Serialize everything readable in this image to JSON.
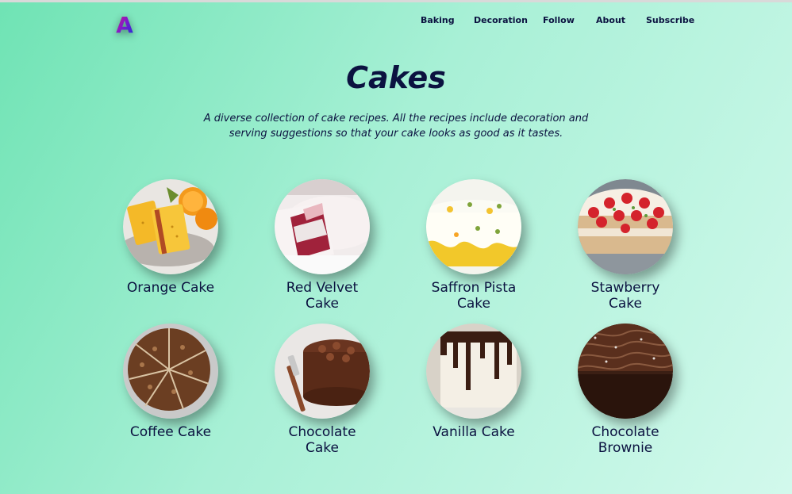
{
  "nav": {
    "items": [
      "Baking",
      "Decoration",
      "Follow",
      "About",
      "Subscribe"
    ]
  },
  "logo": {
    "letter": "A"
  },
  "hero": {
    "title": "Cakes",
    "subtitle": "A diverse collection of cake recipes. All the recipes include decoration and serving suggestions so that your cake looks as good as it tastes."
  },
  "cakes": [
    {
      "name": "Orange Cake",
      "icon": "orange-cake-photo"
    },
    {
      "name": "Red Velvet Cake",
      "icon": "red-velvet-cake-photo"
    },
    {
      "name": "Saffron Pista Cake",
      "icon": "saffron-pista-cake-photo"
    },
    {
      "name": "Stawberry Cake",
      "icon": "strawberry-cake-photo"
    },
    {
      "name": "Coffee Cake",
      "icon": "coffee-cake-photo"
    },
    {
      "name": "Chocolate Cake",
      "icon": "chocolate-cake-photo"
    },
    {
      "name": "Vanilla Cake",
      "icon": "vanilla-cake-photo"
    },
    {
      "name": "Chocolate Brownie",
      "icon": "chocolate-brownie-photo"
    }
  ]
}
